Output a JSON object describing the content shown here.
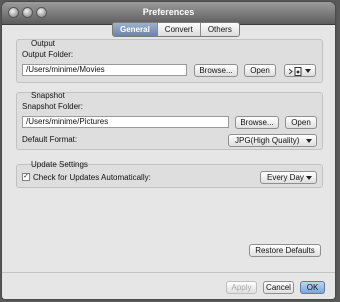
{
  "window": {
    "title": "Preferences"
  },
  "tabs": [
    {
      "label": "General"
    },
    {
      "label": "Convert"
    },
    {
      "label": "Others"
    }
  ],
  "output": {
    "title": "Output",
    "folder_label": "Output Folder:",
    "folder_value": "/Users/minime/Movies",
    "browse_label": "Browse...",
    "open_label": "Open"
  },
  "snapshot": {
    "title": "Snapshot",
    "folder_label": "Snapshot Folder:",
    "folder_value": "/Users/minime/Pictures",
    "browse_label": "Browse...",
    "open_label": "Open",
    "format_label": "Default Format:",
    "format_value": "JPG(High Quality)"
  },
  "update": {
    "title": "Update Settings",
    "check_label": "Check for Updates Automatically:",
    "checked": true,
    "frequency_value": "Every Day"
  },
  "footer": {
    "restore_label": "Restore Defaults",
    "apply_label": "Apply",
    "cancel_label": "Cancel",
    "ok_label": "OK"
  }
}
